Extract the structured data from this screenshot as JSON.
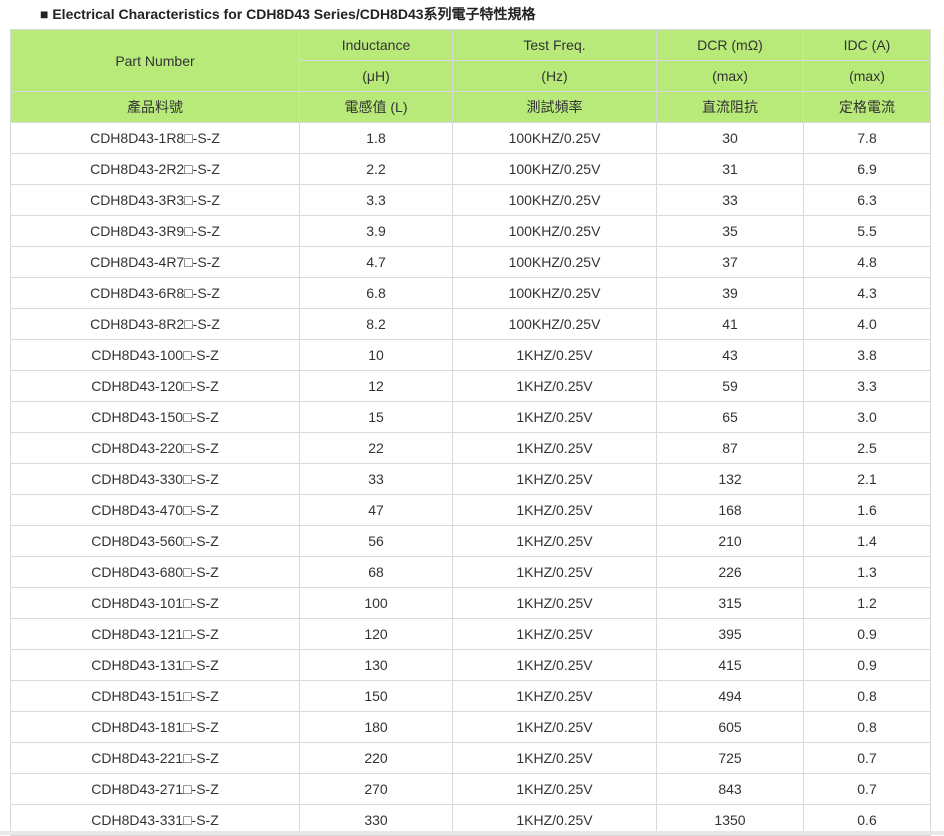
{
  "heading": "■ Electrical Characteristics for CDH8D43 Series/CDH8D43系列電子特性規格",
  "header": {
    "part_number": "Part Number",
    "part_number_zh": "產品料號",
    "inductance": "Inductance",
    "inductance_unit": "(μH)",
    "inductance_zh": "電感值 (L)",
    "test_freq": "Test Freq.",
    "test_freq_unit": "(Hz)",
    "test_freq_zh": "測試頻率",
    "dcr": "DCR (mΩ)",
    "dcr_unit": "(max)",
    "dcr_zh": "直流阻抗",
    "idc": "IDC (A)",
    "idc_unit": "(max)",
    "idc_zh": "定格電流"
  },
  "rows": [
    [
      "CDH8D43-1R8□-S-Z",
      "1.8",
      "100KHZ/0.25V",
      "30",
      "7.8"
    ],
    [
      "CDH8D43-2R2□-S-Z",
      "2.2",
      "100KHZ/0.25V",
      "31",
      "6.9"
    ],
    [
      "CDH8D43-3R3□-S-Z",
      "3.3",
      "100KHZ/0.25V",
      "33",
      "6.3"
    ],
    [
      "CDH8D43-3R9□-S-Z",
      "3.9",
      "100KHZ/0.25V",
      "35",
      "5.5"
    ],
    [
      "CDH8D43-4R7□-S-Z",
      "4.7",
      "100KHZ/0.25V",
      "37",
      "4.8"
    ],
    [
      "CDH8D43-6R8□-S-Z",
      "6.8",
      "100KHZ/0.25V",
      "39",
      "4.3"
    ],
    [
      "CDH8D43-8R2□-S-Z",
      "8.2",
      "100KHZ/0.25V",
      "41",
      "4.0"
    ],
    [
      "CDH8D43-100□-S-Z",
      "10",
      "1KHZ/0.25V",
      "43",
      "3.8"
    ],
    [
      "CDH8D43-120□-S-Z",
      "12",
      "1KHZ/0.25V",
      "59",
      "3.3"
    ],
    [
      "CDH8D43-150□-S-Z",
      "15",
      "1KHZ/0.25V",
      "65",
      "3.0"
    ],
    [
      "CDH8D43-220□-S-Z",
      "22",
      "1KHZ/0.25V",
      "87",
      "2.5"
    ],
    [
      "CDH8D43-330□-S-Z",
      "33",
      "1KHZ/0.25V",
      "132",
      "2.1"
    ],
    [
      "CDH8D43-470□-S-Z",
      "47",
      "1KHZ/0.25V",
      "168",
      "1.6"
    ],
    [
      "CDH8D43-560□-S-Z",
      "56",
      "1KHZ/0.25V",
      "210",
      "1.4"
    ],
    [
      "CDH8D43-680□-S-Z",
      "68",
      "1KHZ/0.25V",
      "226",
      "1.3"
    ],
    [
      "CDH8D43-101□-S-Z",
      "100",
      "1KHZ/0.25V",
      "315",
      "1.2"
    ],
    [
      "CDH8D43-121□-S-Z",
      "120",
      "1KHZ/0.25V",
      "395",
      "0.9"
    ],
    [
      "CDH8D43-131□-S-Z",
      "130",
      "1KHZ/0.25V",
      "415",
      "0.9"
    ],
    [
      "CDH8D43-151□-S-Z",
      "150",
      "1KHZ/0.25V",
      "494",
      "0.8"
    ],
    [
      "CDH8D43-181□-S-Z",
      "180",
      "1KHZ/0.25V",
      "605",
      "0.8"
    ],
    [
      "CDH8D43-221□-S-Z",
      "220",
      "1KHZ/0.25V",
      "725",
      "0.7"
    ],
    [
      "CDH8D43-271□-S-Z",
      "270",
      "1KHZ/0.25V",
      "843",
      "0.7"
    ],
    [
      "CDH8D43-331□-S-Z",
      "330",
      "1KHZ/0.25V",
      "1350",
      "0.6"
    ]
  ],
  "colors": {
    "header_bg": "#b8ea7a",
    "border": "#d9d9d9",
    "text": "#333333"
  }
}
